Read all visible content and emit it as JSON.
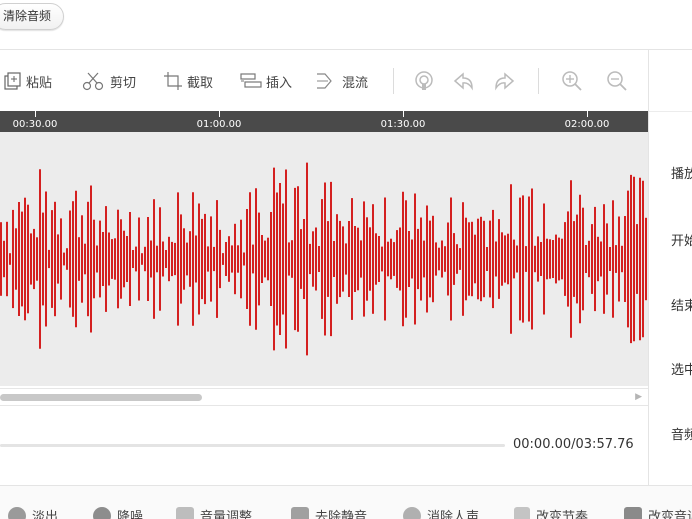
{
  "topbar": {
    "clear_audio_label": "清除音频"
  },
  "toolbar": {
    "paste_label": "粘贴",
    "cut_label": "剪切",
    "crop_label": "截取",
    "insert_label": "插入",
    "mix_label": "混流"
  },
  "timeline": {
    "ticks": [
      "00:30.00",
      "01:00.00",
      "01:30.00",
      "02:00.00"
    ]
  },
  "player": {
    "time_display": "00:00.00/03:57.76"
  },
  "side_panel": {
    "play_label": "播放",
    "start_label": "开始",
    "end_label": "结束",
    "selection_label": "选中",
    "audio_label": "音频"
  },
  "bottom_tools": {
    "fade_out_label": "淡出",
    "denoise_label": "降噪",
    "volume_label": "音量调整",
    "remove_silence_label": "去除静音",
    "remove_vocals_label": "消除人声",
    "change_tempo_label": "改变节奏",
    "change_pitch_label": "改变音调"
  },
  "colors": {
    "waveform": "#d42020",
    "ruler": "#4a4a4a",
    "wave_bg": "#ececec"
  }
}
